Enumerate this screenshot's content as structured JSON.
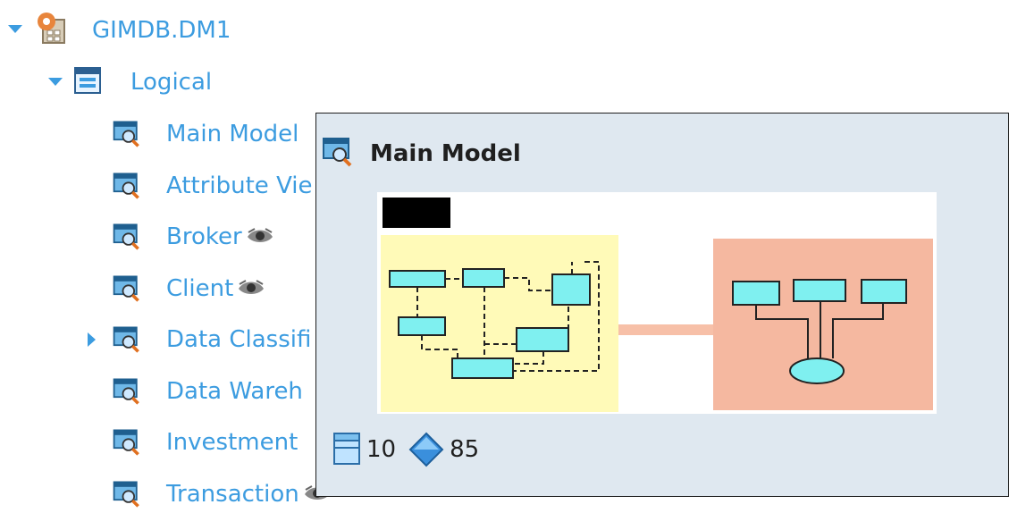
{
  "tree": {
    "root": {
      "label": "GIMDB.DM1"
    },
    "logical": {
      "label": "Logical"
    },
    "items": [
      {
        "label": "Main Model",
        "expander": false,
        "eye": false
      },
      {
        "label": "Attribute Vie",
        "expander": false,
        "eye": false
      },
      {
        "label": "Broker",
        "expander": false,
        "eye": true
      },
      {
        "label": "Client",
        "expander": false,
        "eye": true
      },
      {
        "label": "Data Classifi",
        "expander": true,
        "eye": false
      },
      {
        "label": "Data Wareh",
        "expander": false,
        "eye": false
      },
      {
        "label": "Investment",
        "expander": false,
        "eye": false
      },
      {
        "label": "Transaction",
        "expander": false,
        "eye": true
      }
    ]
  },
  "popup": {
    "title": "Main Model",
    "entity_count": "10",
    "attribute_count": "85"
  },
  "colors": {
    "link": "#3c9ce0",
    "popup_bg": "#dfe8f0",
    "diagram_yellow": "#fffab8",
    "diagram_salmon": "#f5b8a0",
    "entity_cyan": "#7ff0f0"
  }
}
